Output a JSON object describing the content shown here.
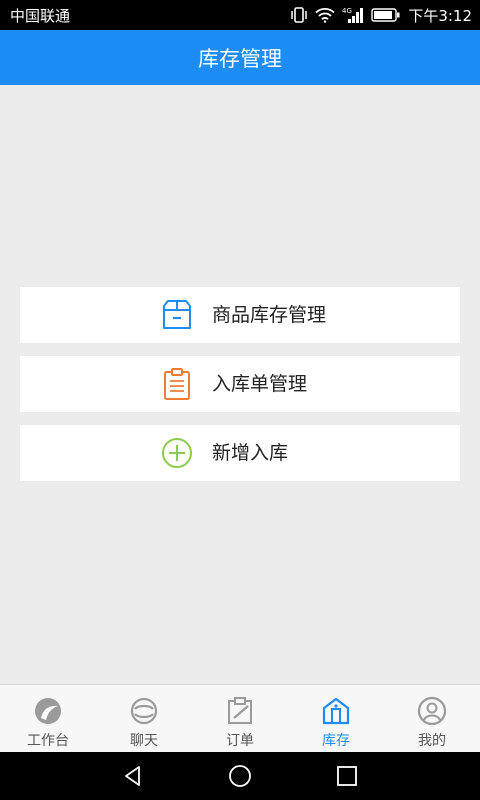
{
  "status_bar": {
    "carrier": "中国联通",
    "network": "4G",
    "time": "下午3:12"
  },
  "header": {
    "title": "库存管理"
  },
  "menu": [
    {
      "label": "商品库存管理",
      "icon": "box-icon",
      "color": "#1e8cf5"
    },
    {
      "label": "入库单管理",
      "icon": "clipboard-icon",
      "color": "#f07c34"
    },
    {
      "label": "新增入库",
      "icon": "plus-circle-icon",
      "color": "#8ccb4c"
    }
  ],
  "bottom_nav": [
    {
      "label": "工作台",
      "icon": "workbench-icon"
    },
    {
      "label": "聊天",
      "icon": "chat-icon"
    },
    {
      "label": "订单",
      "icon": "order-icon"
    },
    {
      "label": "库存",
      "icon": "warehouse-icon",
      "active": true
    },
    {
      "label": "我的",
      "icon": "profile-icon"
    }
  ],
  "colors": {
    "accent": "#1e8cf5",
    "inactive": "#9a9a9a"
  }
}
